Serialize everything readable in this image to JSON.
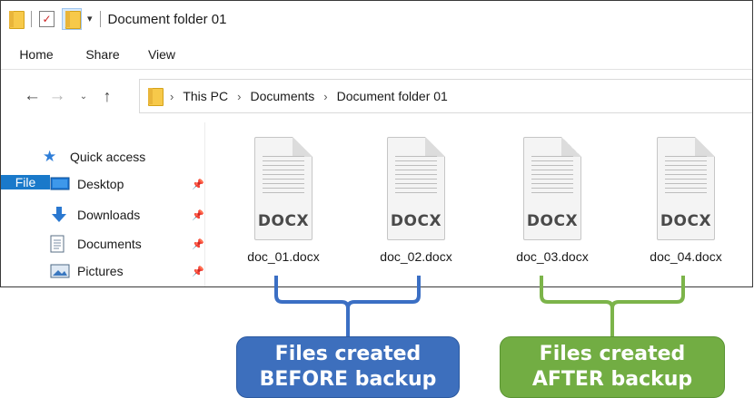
{
  "window": {
    "title": "Document folder 01"
  },
  "quick_access_toolbar": {
    "icons": [
      "folder-icon",
      "properties-icon",
      "new-folder-icon",
      "chevron-down-icon"
    ]
  },
  "ribbon": {
    "tabs": [
      {
        "label": "File",
        "active": true
      },
      {
        "label": "Home"
      },
      {
        "label": "Share"
      },
      {
        "label": "View"
      }
    ]
  },
  "address_bar": {
    "crumbs": [
      "This PC",
      "Documents",
      "Document folder 01"
    ],
    "separator": "›"
  },
  "nav_pane": {
    "quick_access_label": "Quick access",
    "items": [
      {
        "label": "Desktop",
        "icon": "desktop-icon",
        "pinned": true
      },
      {
        "label": "Downloads",
        "icon": "downloads-icon",
        "pinned": true
      },
      {
        "label": "Documents",
        "icon": "documents-icon",
        "pinned": true
      },
      {
        "label": "Pictures",
        "icon": "pictures-icon",
        "pinned": true
      }
    ]
  },
  "files": [
    {
      "name": "doc_01.docx",
      "type_badge": "DOCX"
    },
    {
      "name": "doc_02.docx",
      "type_badge": "DOCX"
    },
    {
      "name": "doc_03.docx",
      "type_badge": "DOCX"
    },
    {
      "name": "doc_04.docx",
      "type_badge": "DOCX"
    }
  ],
  "annotations": {
    "before": {
      "line1": "Files created",
      "line2": "BEFORE backup",
      "color": "#3d6fbd",
      "bracket_color": "#3b6fc4"
    },
    "after": {
      "line1": "Files created",
      "line2": "AFTER backup",
      "color": "#72ad43",
      "bracket_color": "#7cb44a"
    }
  },
  "colors": {
    "file_tab": "#1979ca",
    "folder": "#f7c94a"
  }
}
